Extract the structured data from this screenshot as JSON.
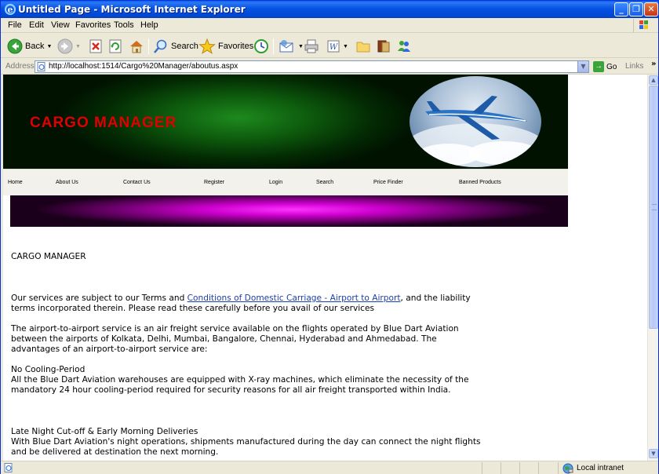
{
  "window": {
    "title": "Untitled Page - Microsoft Internet Explorer",
    "minimize": "_",
    "maximize": "❐",
    "close": "✕"
  },
  "menubar": {
    "items": [
      "File",
      "Edit",
      "View",
      "Favorites",
      "Tools",
      "Help"
    ]
  },
  "toolbar": {
    "back_label": "Back",
    "search_label": "Search",
    "favorites_label": "Favorites"
  },
  "addressbar": {
    "label": "Address",
    "url": "http://localhost:1514/Cargo%20Manager/aboutus.aspx",
    "go_label": "Go",
    "links_label": "Links",
    "links_chevron": "»"
  },
  "page": {
    "site_title": "CARGO MANAGER",
    "nav": [
      "Home",
      "About Us",
      "Contact Us",
      "Register",
      "Login",
      "Search",
      "Price Finder",
      "Banned Products"
    ],
    "heading": "CARGO MANAGER",
    "para1_before": "Our services are subject to our Terms and ",
    "para1_link": "Conditions of Domestic Carriage - Airport to Airport",
    "para1_after": ", and the liability terms incorporated therein. Please read these carefully before you avail of our services",
    "para2": "The airport-to-airport service is an air freight service available on the flights operated by Blue Dart Aviation between the airports of Kolkata, Delhi, Mumbai, Bangalore, Chennai, Hyderabad and Ahmedabad. The advantages of an airport-to-airport service are:",
    "section1_title": "No Cooling-Period",
    "section1_body": "All the Blue Dart Aviation warehouses are equipped with X-ray machines, which eliminate the necessity of the mandatory 24 hour cooling-period required for security reasons for all air freight transported within India.",
    "section2_title": "Late Night Cut-off & Early Morning Deliveries",
    "section2_body": "With Blue Dart Aviation's night operations, shipments manufactured during the day can connect the night flights and be delivered at destination the next morning."
  },
  "statusbar": {
    "zone": "Local intranet"
  },
  "colors": {
    "title_bar": "#0553e3",
    "site_title": "#e00000",
    "banner": "#0d5a0d",
    "stripe": "#cc00cc",
    "link": "#1a3fae"
  }
}
